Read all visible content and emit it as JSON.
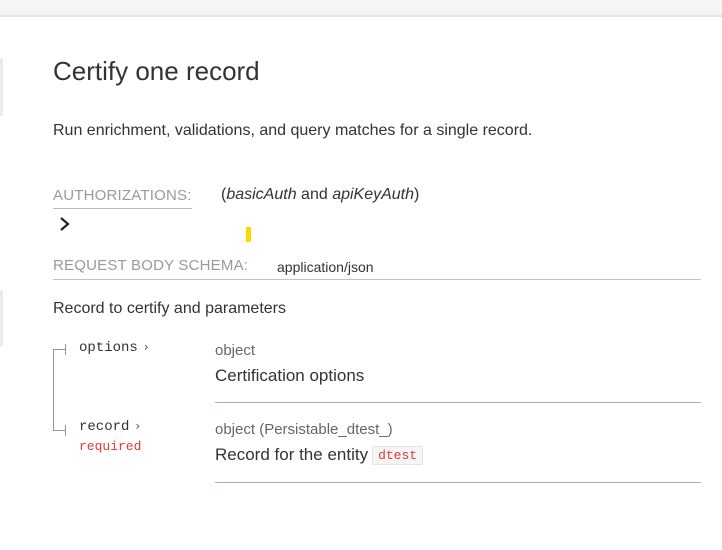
{
  "operation": {
    "title": "Certify one record",
    "description": "Run enrichment, validations, and query matches for a single record."
  },
  "authorizations": {
    "label": "AUTHORIZATIONS:",
    "open_paren": "(",
    "scheme_1": "basicAuth",
    "joiner": " and ",
    "scheme_2": "apiKeyAuth",
    "close_paren": ")",
    "toggle_icon": "chevron-right-icon"
  },
  "request_body": {
    "label": "REQUEST BODY SCHEMA:",
    "content_type": "application/json",
    "description": "Record to certify and parameters"
  },
  "properties": [
    {
      "name": "options",
      "chevron": "›",
      "required": "",
      "type": "object",
      "description": "Certification options"
    },
    {
      "name": "record",
      "chevron": "›",
      "required": "required",
      "type": "object (Persistable_dtest_)",
      "description": "Record for the entity",
      "code": "dtest"
    }
  ],
  "colors": {
    "required": "#e53935",
    "marker": "#ffd700"
  }
}
